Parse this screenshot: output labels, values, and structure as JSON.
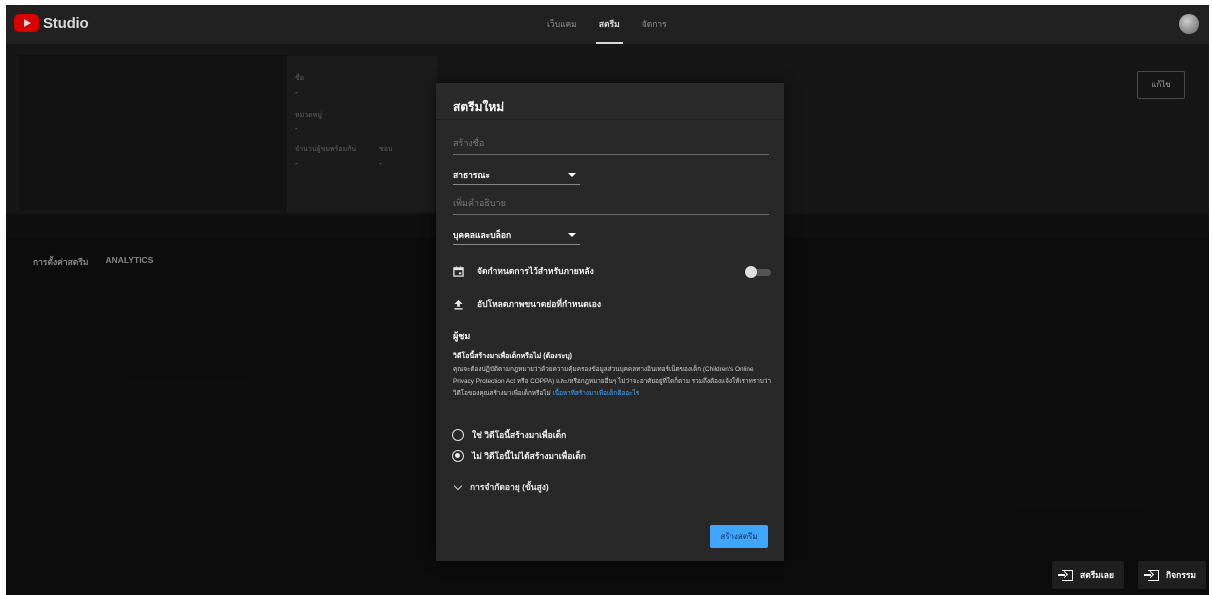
{
  "app": {
    "logo_text": "Studio",
    "brand_color": "#ff0000",
    "accent_color": "#3ea6ff"
  },
  "topbar": {
    "tabs": [
      {
        "label": "เว็บแคม",
        "active": false
      },
      {
        "label": "สตรีม",
        "active": true
      },
      {
        "label": "จัดการ",
        "active": false
      }
    ]
  },
  "stream_info": {
    "title_label": "ชื่อ",
    "title_value": "-",
    "category_label": "หมวดหมู่",
    "category_value": "-",
    "viewers_label": "จำนวนผู้ชมพร้อมกัน",
    "viewers_value": "-",
    "likes_label": "ชอบ",
    "likes_value": "-",
    "edit_label": "แก้ไข"
  },
  "subtabs": [
    "การตั้งค่าสตรีม",
    "ANALYTICS"
  ],
  "dialog": {
    "title": "สตรีมใหม่",
    "title_placeholder": "สร้างชื่อ",
    "privacy_value": "สาธารณะ",
    "description_placeholder": "เพิ่มคำอธิบาย",
    "category_value": "บุคคลและบล็อก",
    "schedule_label": "จัดกำหนดการไว้สำหรับภายหลัง",
    "schedule_enabled": false,
    "thumbnail_label": "อัปโหลดภาพขนาดย่อที่กำหนดเอง",
    "audience_heading": "ผู้ชม",
    "kids_heading": "วิดีโอนี้สร้างมาเพื่อเด็กหรือไม่ (ต้องระบุ)",
    "kids_text": "คุณจะต้องปฏิบัติตามกฎหมายว่าด้วยความคุ้มครองข้อมูลส่วนบุคคลทางอินเทอร์เน็ตของเด็ก (Children's Online Privacy Protection Act หรือ COPPA) และ/หรือกฎหมายอื่นๆ ไม่ว่าจะอาศัยอยู่ที่ใดก็ตาม รวมถึงต้องแจ้งให้เราทราบว่าวิดีโอของคุณสร้างมาเพื่อเด็กหรือไม่",
    "kids_link": "เนื้อหาที่สร้างมาเพื่อเด็กคืออะไร",
    "radio_yes": "ใช่ วิดีโอนี้สร้างมาเพื่อเด็ก",
    "radio_no": "ไม่ วิดีโอนี้ไม่ได้สร้างมาเพื่อเด็ก",
    "selected_option": "no",
    "advanced_label": "การจำกัดอายุ (ขั้นสูง)",
    "create_button": "สร้างสตรีม"
  },
  "bottom": {
    "stream_now": "สตรีมเลย",
    "activity": "กิจกรรม"
  },
  "icons": [
    "calendar-icon",
    "upload-icon",
    "chevron-down-icon",
    "exit-icon"
  ]
}
